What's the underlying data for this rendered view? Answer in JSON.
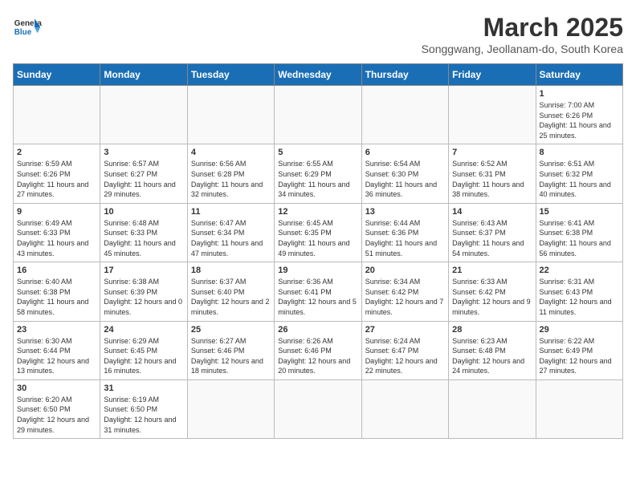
{
  "logo": {
    "text_general": "General",
    "text_blue": "Blue"
  },
  "title": "March 2025",
  "subtitle": "Songgwang, Jeollanam-do, South Korea",
  "days_of_week": [
    "Sunday",
    "Monday",
    "Tuesday",
    "Wednesday",
    "Thursday",
    "Friday",
    "Saturday"
  ],
  "weeks": [
    [
      {
        "day": "",
        "info": ""
      },
      {
        "day": "",
        "info": ""
      },
      {
        "day": "",
        "info": ""
      },
      {
        "day": "",
        "info": ""
      },
      {
        "day": "",
        "info": ""
      },
      {
        "day": "",
        "info": ""
      },
      {
        "day": "1",
        "info": "Sunrise: 7:00 AM\nSunset: 6:26 PM\nDaylight: 11 hours and 25 minutes."
      }
    ],
    [
      {
        "day": "2",
        "info": "Sunrise: 6:59 AM\nSunset: 6:26 PM\nDaylight: 11 hours and 27 minutes."
      },
      {
        "day": "3",
        "info": "Sunrise: 6:57 AM\nSunset: 6:27 PM\nDaylight: 11 hours and 29 minutes."
      },
      {
        "day": "4",
        "info": "Sunrise: 6:56 AM\nSunset: 6:28 PM\nDaylight: 11 hours and 32 minutes."
      },
      {
        "day": "5",
        "info": "Sunrise: 6:55 AM\nSunset: 6:29 PM\nDaylight: 11 hours and 34 minutes."
      },
      {
        "day": "6",
        "info": "Sunrise: 6:54 AM\nSunset: 6:30 PM\nDaylight: 11 hours and 36 minutes."
      },
      {
        "day": "7",
        "info": "Sunrise: 6:52 AM\nSunset: 6:31 PM\nDaylight: 11 hours and 38 minutes."
      },
      {
        "day": "8",
        "info": "Sunrise: 6:51 AM\nSunset: 6:32 PM\nDaylight: 11 hours and 40 minutes."
      }
    ],
    [
      {
        "day": "9",
        "info": "Sunrise: 6:49 AM\nSunset: 6:33 PM\nDaylight: 11 hours and 43 minutes."
      },
      {
        "day": "10",
        "info": "Sunrise: 6:48 AM\nSunset: 6:33 PM\nDaylight: 11 hours and 45 minutes."
      },
      {
        "day": "11",
        "info": "Sunrise: 6:47 AM\nSunset: 6:34 PM\nDaylight: 11 hours and 47 minutes."
      },
      {
        "day": "12",
        "info": "Sunrise: 6:45 AM\nSunset: 6:35 PM\nDaylight: 11 hours and 49 minutes."
      },
      {
        "day": "13",
        "info": "Sunrise: 6:44 AM\nSunset: 6:36 PM\nDaylight: 11 hours and 51 minutes."
      },
      {
        "day": "14",
        "info": "Sunrise: 6:43 AM\nSunset: 6:37 PM\nDaylight: 11 hours and 54 minutes."
      },
      {
        "day": "15",
        "info": "Sunrise: 6:41 AM\nSunset: 6:38 PM\nDaylight: 11 hours and 56 minutes."
      }
    ],
    [
      {
        "day": "16",
        "info": "Sunrise: 6:40 AM\nSunset: 6:38 PM\nDaylight: 11 hours and 58 minutes."
      },
      {
        "day": "17",
        "info": "Sunrise: 6:38 AM\nSunset: 6:39 PM\nDaylight: 12 hours and 0 minutes."
      },
      {
        "day": "18",
        "info": "Sunrise: 6:37 AM\nSunset: 6:40 PM\nDaylight: 12 hours and 2 minutes."
      },
      {
        "day": "19",
        "info": "Sunrise: 6:36 AM\nSunset: 6:41 PM\nDaylight: 12 hours and 5 minutes."
      },
      {
        "day": "20",
        "info": "Sunrise: 6:34 AM\nSunset: 6:42 PM\nDaylight: 12 hours and 7 minutes."
      },
      {
        "day": "21",
        "info": "Sunrise: 6:33 AM\nSunset: 6:42 PM\nDaylight: 12 hours and 9 minutes."
      },
      {
        "day": "22",
        "info": "Sunrise: 6:31 AM\nSunset: 6:43 PM\nDaylight: 12 hours and 11 minutes."
      }
    ],
    [
      {
        "day": "23",
        "info": "Sunrise: 6:30 AM\nSunset: 6:44 PM\nDaylight: 12 hours and 13 minutes."
      },
      {
        "day": "24",
        "info": "Sunrise: 6:29 AM\nSunset: 6:45 PM\nDaylight: 12 hours and 16 minutes."
      },
      {
        "day": "25",
        "info": "Sunrise: 6:27 AM\nSunset: 6:46 PM\nDaylight: 12 hours and 18 minutes."
      },
      {
        "day": "26",
        "info": "Sunrise: 6:26 AM\nSunset: 6:46 PM\nDaylight: 12 hours and 20 minutes."
      },
      {
        "day": "27",
        "info": "Sunrise: 6:24 AM\nSunset: 6:47 PM\nDaylight: 12 hours and 22 minutes."
      },
      {
        "day": "28",
        "info": "Sunrise: 6:23 AM\nSunset: 6:48 PM\nDaylight: 12 hours and 24 minutes."
      },
      {
        "day": "29",
        "info": "Sunrise: 6:22 AM\nSunset: 6:49 PM\nDaylight: 12 hours and 27 minutes."
      }
    ],
    [
      {
        "day": "30",
        "info": "Sunrise: 6:20 AM\nSunset: 6:50 PM\nDaylight: 12 hours and 29 minutes."
      },
      {
        "day": "31",
        "info": "Sunrise: 6:19 AM\nSunset: 6:50 PM\nDaylight: 12 hours and 31 minutes."
      },
      {
        "day": "",
        "info": ""
      },
      {
        "day": "",
        "info": ""
      },
      {
        "day": "",
        "info": ""
      },
      {
        "day": "",
        "info": ""
      },
      {
        "day": "",
        "info": ""
      }
    ]
  ]
}
